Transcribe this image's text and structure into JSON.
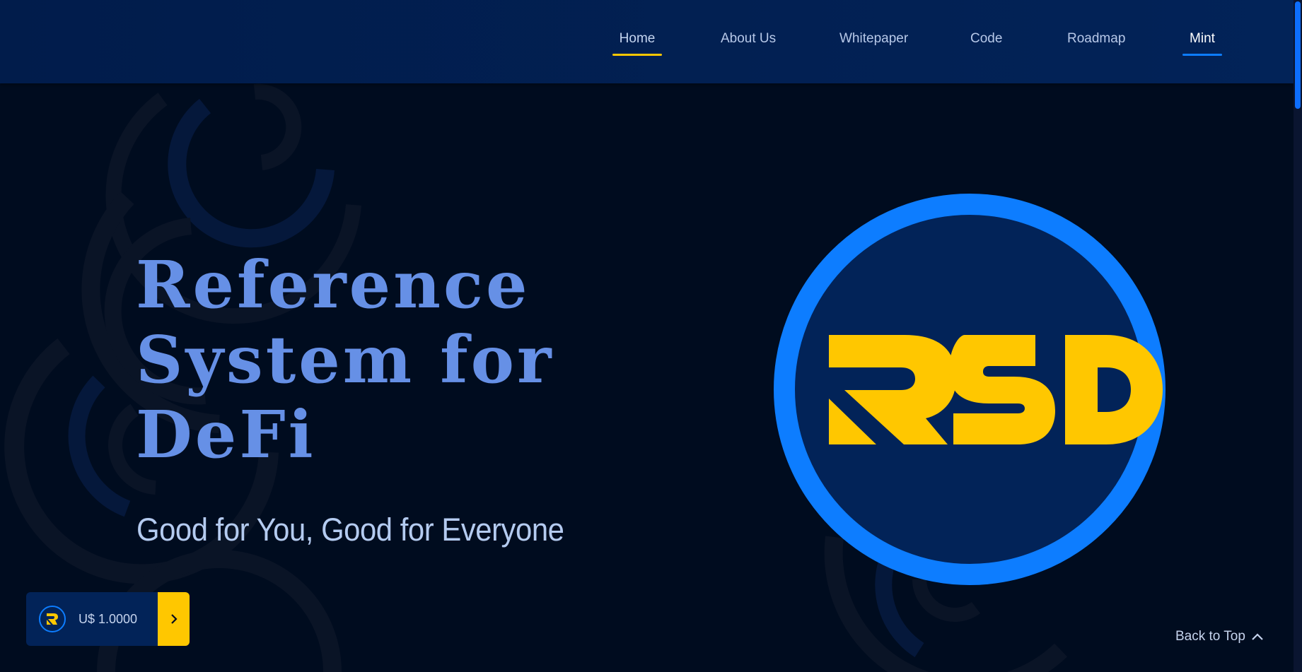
{
  "nav": {
    "items": [
      {
        "label": "Home"
      },
      {
        "label": "About Us"
      },
      {
        "label": "Whitepaper"
      },
      {
        "label": "Code"
      },
      {
        "label": "Roadmap"
      },
      {
        "label": "Mint"
      }
    ]
  },
  "hero": {
    "title": "Reference System for DeFi",
    "subtitle": "Good for You, Good for Everyone"
  },
  "logo": {
    "text": "RSD",
    "icon": "rsd-logo-icon"
  },
  "price_widget": {
    "value": "U$ 1.0000",
    "coin_icon": "rsd-coin-icon",
    "button_icon": "chevron-right-icon"
  },
  "back_to_top": {
    "label": "Back to Top",
    "icon": "chevron-up-icon"
  },
  "colors": {
    "background": "#000c1f",
    "header": "#022358",
    "accent_blue": "#0d7dff",
    "accent_yellow": "#ffc700",
    "title": "#6690e6",
    "subtitle": "#b4cbf0"
  }
}
